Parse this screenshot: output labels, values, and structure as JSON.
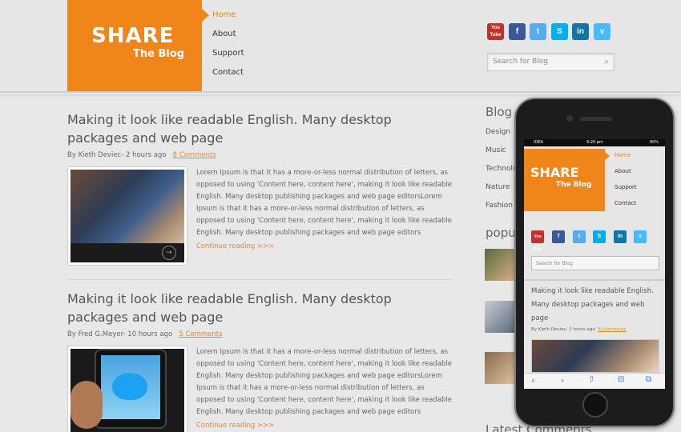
{
  "logo": {
    "title": "SHARE",
    "subtitle": "The Blog"
  },
  "nav": [
    "Home",
    "About",
    "Support",
    "Contact"
  ],
  "social": [
    {
      "name": "youtube-icon",
      "label": "You Tube",
      "color": "#c4302b"
    },
    {
      "name": "facebook-icon",
      "label": "f",
      "color": "#3b5998"
    },
    {
      "name": "twitter-icon",
      "label": "t",
      "color": "#55acee"
    },
    {
      "name": "skype-icon",
      "label": "S",
      "color": "#00aff0"
    },
    {
      "name": "linkedin-icon",
      "label": "in",
      "color": "#0e76a8"
    },
    {
      "name": "vimeo-icon",
      "label": "v",
      "color": "#44bbff"
    }
  ],
  "search": {
    "placeholder": "Search for Blog"
  },
  "posts": [
    {
      "title": "Making it look like readable English. Many desktop packages and web page",
      "author": "By Kieth Deviec- 2 hours ago",
      "comments": "8 Comments",
      "body": "Lorem Ipsum is that it has a more-or-less normal distribution of letters, as opposed to using 'Content here, content here', making it look like readable English. Many desktop publishing packages and web page editorsLorem Ipsum is that it has a more-or-less normal distribution of letters, as opposed to using 'Content here, content here', making it look like readable English. Many desktop publishing packages and web page editors",
      "more": "Continue reading >>>"
    },
    {
      "title": "Making it look like readable English. Many desktop packages and web page",
      "author": "By Fred G.Meyer- 10 hours ago",
      "comments": "5 Comments",
      "body": "Lorem Ipsum is that it has a more-or-less normal distribution of letters, as opposed to using 'Content here, content here', making it look like readable English. Many desktop publishing packages and web page editorsLorem Ipsum is that it has a more-or-less normal distribution of letters, as opposed to using 'Content here, content here', making it look like readable English. Many desktop publishing packages and web page editors",
      "more": "Continue reading >>>"
    }
  ],
  "sidebar": {
    "blog_heading": "Blog",
    "categories": [
      "Design",
      "Music",
      "Technology",
      "Nature",
      "Fashion"
    ],
    "popular_heading": "popu",
    "latest_heading": "Latest Comments"
  },
  "mobile": {
    "status": {
      "carrier": "IDEA",
      "time": "9:20 pm",
      "battery": "90%"
    },
    "nav": [
      "Home",
      "About",
      "Support",
      "Contact"
    ],
    "search_placeholder": "Search for Blog",
    "post_title": "Making it look like readable English. Many desktop packages and web page",
    "post_author": "By Kieth Deviec- 2 hours ago",
    "post_comments": "8 Comments",
    "toolbar": [
      "‹",
      "›",
      "⇧",
      "⊟",
      "⧉"
    ]
  }
}
